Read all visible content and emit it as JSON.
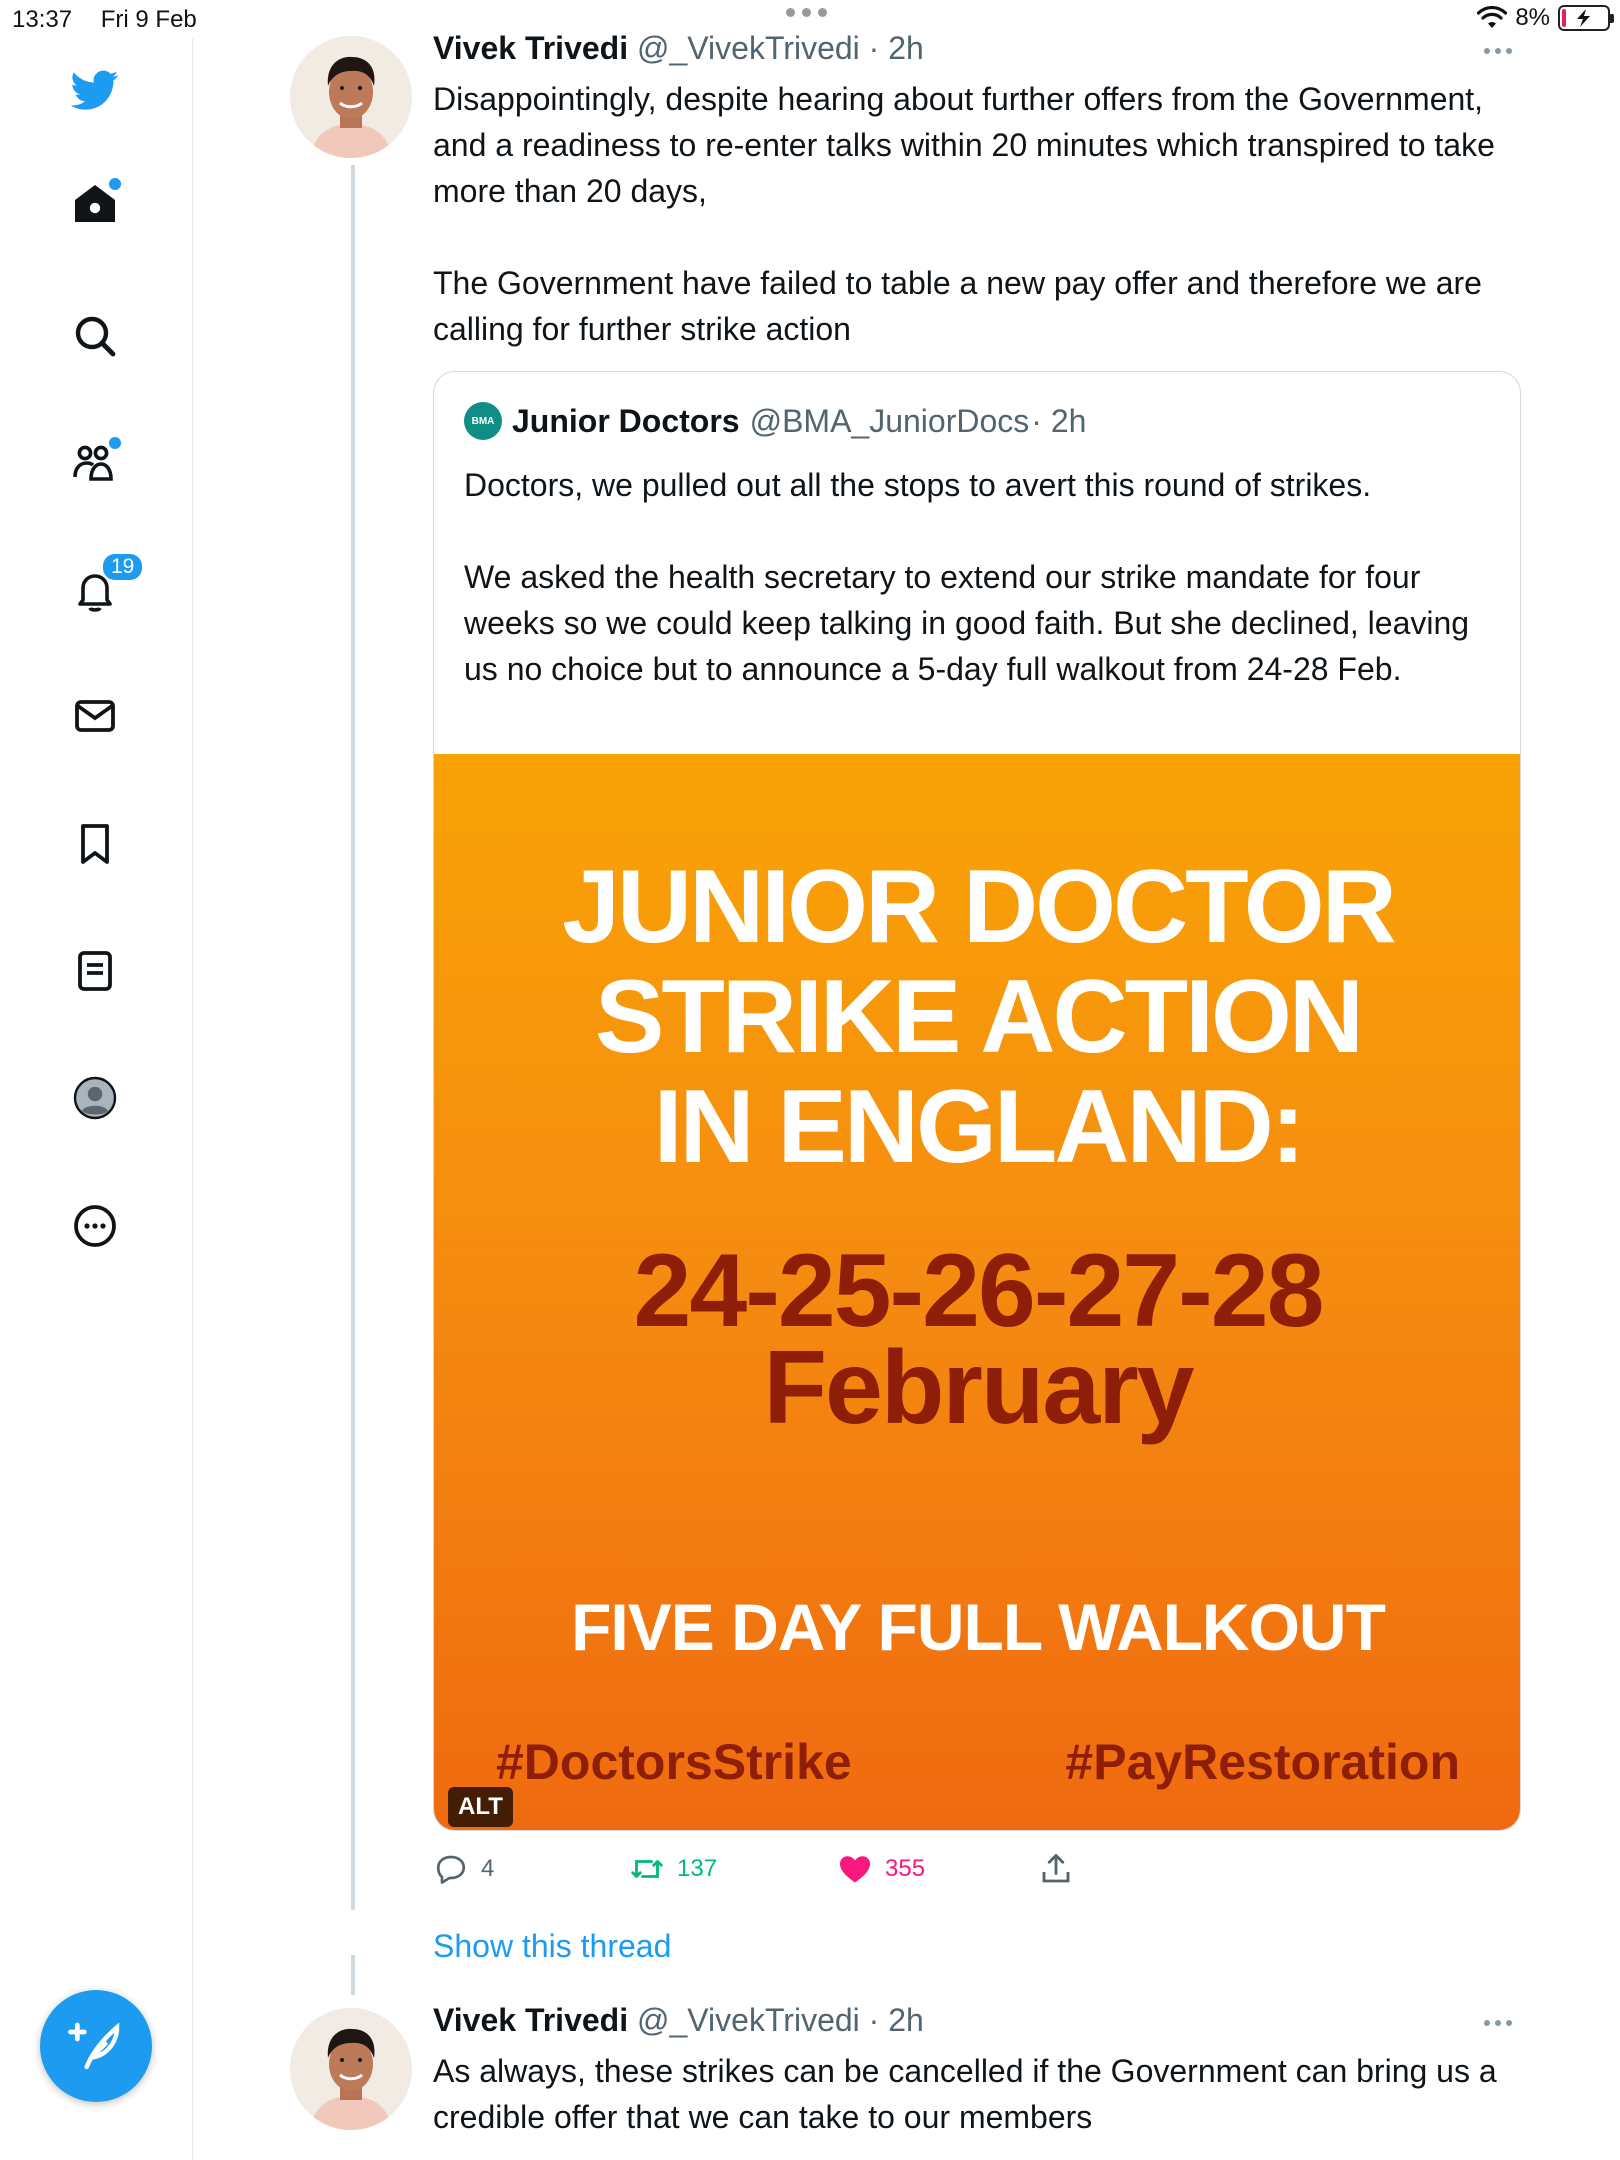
{
  "status_bar": {
    "time": "13:37",
    "date": "Fri 9 Feb",
    "battery": "8%",
    "battery_level": 0.08
  },
  "sidebar": {
    "items": [
      {
        "name": "Home",
        "icon": "home-icon",
        "dot": true
      },
      {
        "name": "Explore",
        "icon": "search-icon"
      },
      {
        "name": "Communities",
        "icon": "communities-icon",
        "dot": true
      },
      {
        "name": "Notifications",
        "icon": "bell-icon",
        "badge": "19"
      },
      {
        "name": "Messages",
        "icon": "envelope-icon"
      },
      {
        "name": "Bookmarks",
        "icon": "bookmark-icon"
      },
      {
        "name": "Lists",
        "icon": "list-icon"
      },
      {
        "name": "Profile",
        "icon": "profile-icon"
      },
      {
        "name": "More",
        "icon": "more-icon"
      }
    ],
    "notifications_badge": "19",
    "brand_color": "#1d9bf0"
  },
  "tweet1": {
    "name": "Vivek Trivedi",
    "handle": "@_VivekTrivedi",
    "time": "· 2h",
    "text": "Disappointingly, despite hearing about further offers from the Government, and a readiness to re-enter talks within 20 minutes which transpired to take more than 20 days,\n\nThe Government have failed to table a new pay offer and therefore we are calling for further strike action",
    "quote": {
      "logo_text": "BMA",
      "name": "Junior Doctors",
      "handle": "@BMA_JuniorDocs",
      "time": "· 2h",
      "text": "Doctors, we pulled out all the stops to avert this round of strikes.\n\nWe asked the health secretary to extend our strike mandate for four weeks so we could keep talking in good faith. But she declined, leaving us no choice but to announce a 5-day full walkout from 24-28 Feb.",
      "image": {
        "title": "JUNIOR DOCTOR\nSTRIKE ACTION\nIN ENGLAND:",
        "dates": "24-25-26-27-28",
        "month": "February",
        "walkout": "FIVE DAY FULL WALKOUT",
        "tag1": "#DoctorsStrike",
        "tag2": "#PayRestoration",
        "alt_label": "ALT"
      }
    },
    "replies": "4",
    "retweets": "137",
    "likes": "355",
    "show_thread": "Show this thread"
  },
  "tweet2": {
    "name": "Vivek Trivedi",
    "handle": "@_VivekTrivedi",
    "time": "· 2h",
    "text": "As always, these strikes can be cancelled if the Government can bring us a credible offer that we can take to our members"
  },
  "colors": {
    "retweet": "#00ba7c",
    "like": "#f91880",
    "poster_orange": "#f58a10",
    "poster_red": "#8e1e08"
  }
}
